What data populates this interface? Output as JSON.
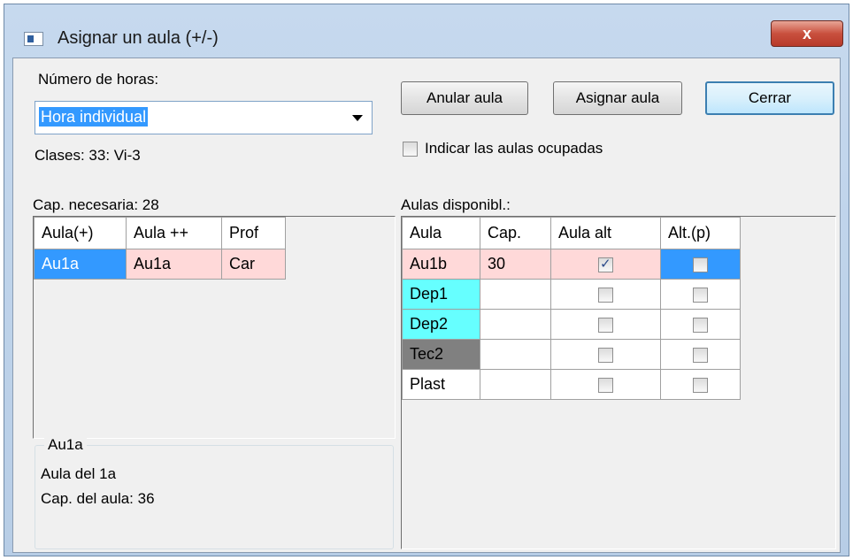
{
  "window": {
    "title": "Asignar un aula (+/-)",
    "close_label": "x"
  },
  "hours": {
    "label": "Número de horas:",
    "value": "Hora individual"
  },
  "classes_text": "Clases: 33: Vi-3",
  "buttons": {
    "anular": "Anular aula",
    "asignar": "Asignar aula",
    "cerrar": "Cerrar"
  },
  "occupied_checkbox": {
    "label": "Indicar las aulas ocupadas",
    "checked": false
  },
  "left_grid": {
    "caption": "Cap. necesaria: 28",
    "headers": [
      "Aula(+)",
      "Aula ++",
      "Prof"
    ],
    "rows": [
      [
        "Au1a",
        "Au1a",
        "Car"
      ]
    ]
  },
  "right_grid": {
    "caption": "Aulas disponibl.:",
    "headers": [
      "Aula",
      "Cap.",
      "Aula alt",
      "Alt.(p)"
    ],
    "rows": [
      {
        "aula": "Au1b",
        "cap": "30",
        "aula_alt": true,
        "alt_p": false
      },
      {
        "aula": "Dep1",
        "cap": "",
        "aula_alt": false,
        "alt_p": false
      },
      {
        "aula": "Dep2",
        "cap": "",
        "aula_alt": false,
        "alt_p": false
      },
      {
        "aula": "Tec2",
        "cap": "",
        "aula_alt": false,
        "alt_p": false
      },
      {
        "aula": "Plast",
        "cap": "",
        "aula_alt": false,
        "alt_p": false
      }
    ]
  },
  "info_group": {
    "title": "Au1a",
    "line1": "Aula del 1a",
    "line2": "Cap. del aula: 36"
  },
  "colors": {
    "selection": "#3399ff",
    "pink": "#ffd9d9",
    "cyan": "#66ffff",
    "gray": "#808080"
  }
}
